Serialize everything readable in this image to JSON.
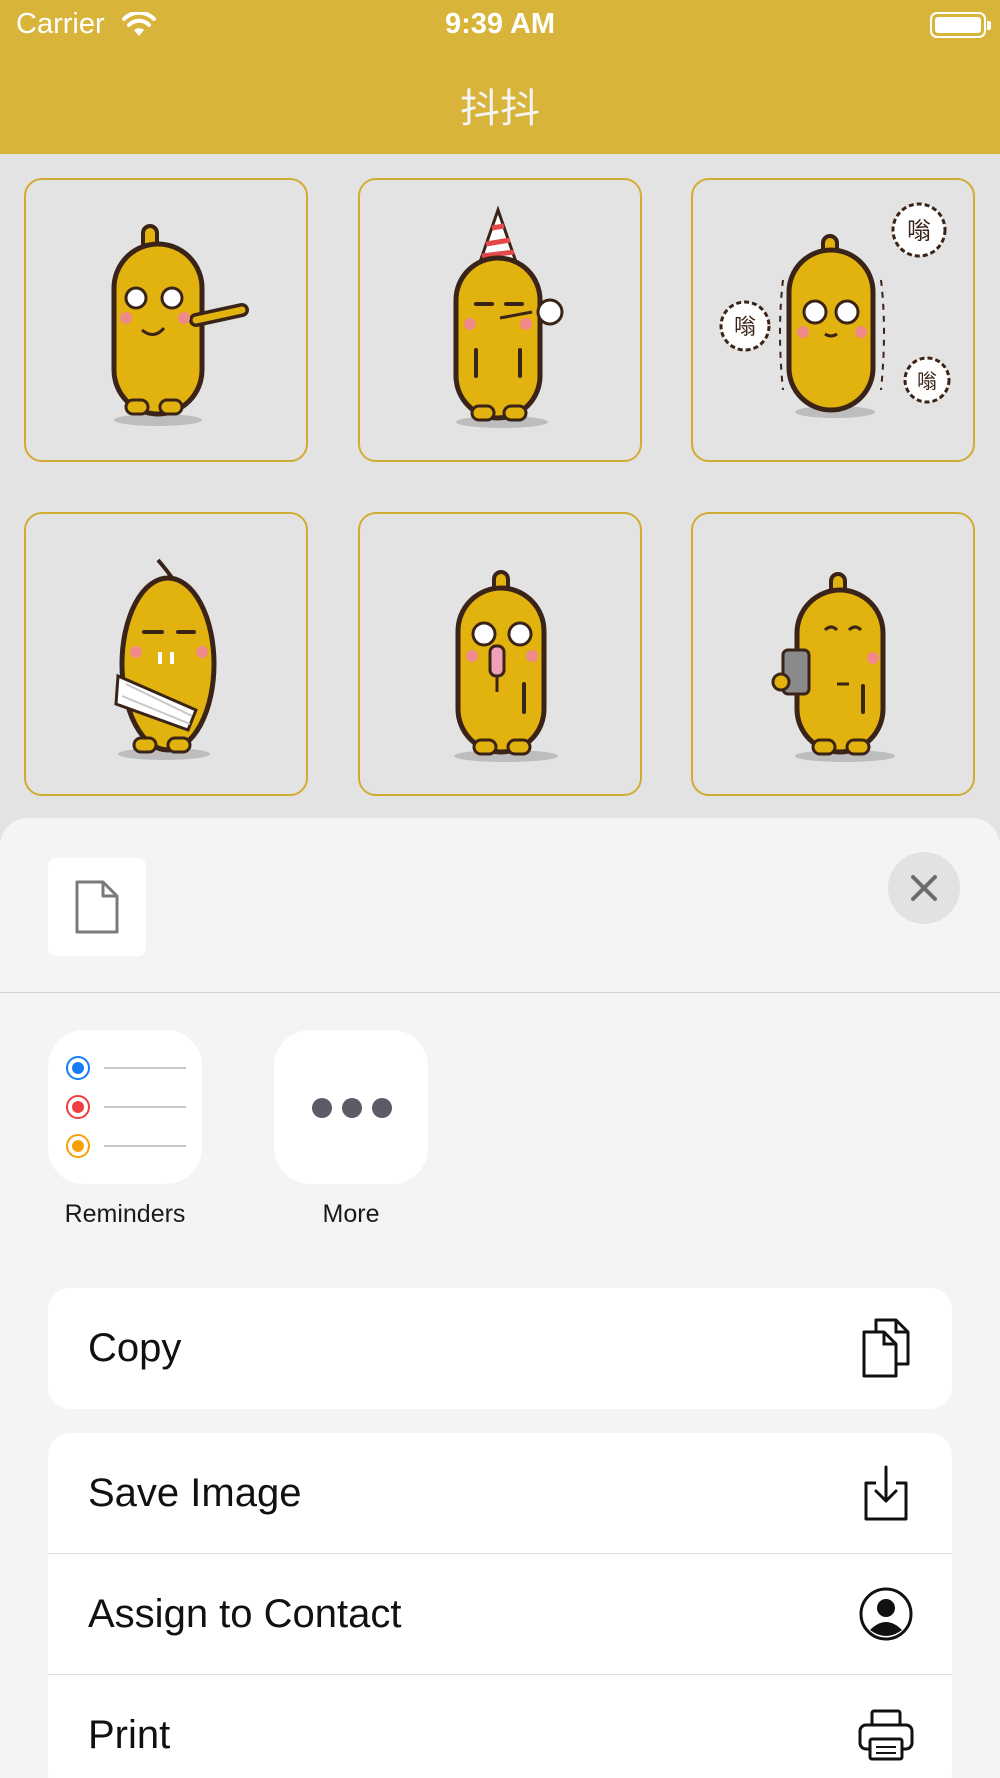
{
  "status_bar": {
    "carrier": "Carrier",
    "time": "9:39 AM"
  },
  "nav": {
    "title": "抖抖"
  },
  "grid": {
    "stickers": [
      {
        "name": "sticker-pointing",
        "bubble_text": ""
      },
      {
        "name": "sticker-party-hat",
        "bubble_text": ""
      },
      {
        "name": "sticker-shaking",
        "bubble_text": "嗡"
      },
      {
        "name": "sticker-fan",
        "bubble_text": ""
      },
      {
        "name": "sticker-popsicle",
        "bubble_text": ""
      },
      {
        "name": "sticker-phone",
        "bubble_text": ""
      }
    ]
  },
  "share_sheet": {
    "apps": [
      {
        "label": "Reminders",
        "icon": "reminders-icon"
      },
      {
        "label": "More",
        "icon": "more-icon"
      }
    ],
    "actions_group1": [
      {
        "label": "Copy",
        "icon": "copy-icon"
      }
    ],
    "actions_group2": [
      {
        "label": "Save Image",
        "icon": "save-image-icon"
      },
      {
        "label": "Assign to Contact",
        "icon": "contact-icon"
      },
      {
        "label": "Print",
        "icon": "print-icon"
      }
    ],
    "colors": {
      "reminder_blue": "#1a7cf5",
      "reminder_red": "#f03e3e",
      "reminder_orange": "#f7a10a"
    }
  },
  "colors": {
    "header": "#d9b43a",
    "sticker_body": "#e2b20f",
    "cell_border": "#d2ac32"
  }
}
